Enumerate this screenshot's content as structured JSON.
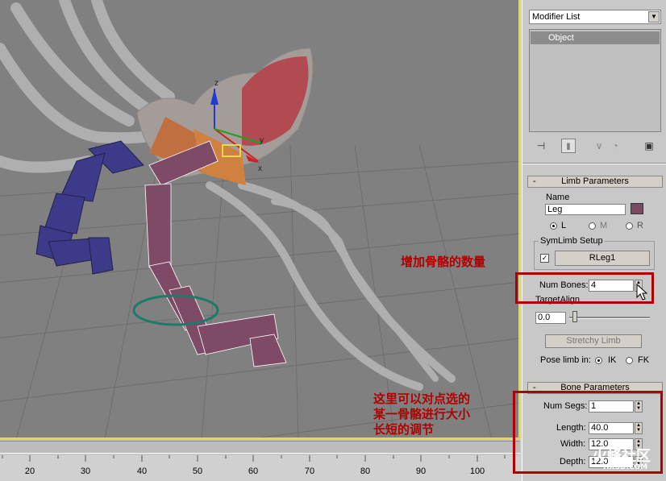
{
  "annotations": {
    "numbones_note": "增加骨骼的数量",
    "adjust_note_line1": "这里可以对点选的",
    "adjust_note_line2": "某一骨骼进行大小",
    "adjust_note_line3": "长短的调节"
  },
  "viewport": {
    "gizmo_labels": {
      "x": "x",
      "y": "y",
      "z": "z"
    }
  },
  "timeline": {
    "ticks": [
      "20",
      "30",
      "40",
      "50",
      "60",
      "70",
      "80",
      "90",
      "100"
    ]
  },
  "panel": {
    "modifier_list": "Modifier List",
    "stack_item": "Object",
    "icons": [
      "pin-stack-icon",
      "show-end-result-icon",
      "make-unique-icon",
      "remove-modifier-icon",
      "configure-sets-icon"
    ],
    "limb": {
      "title": "Limb Parameters",
      "name_label": "Name",
      "name_value": "Leg",
      "color": "#7a4a60",
      "side_l": "L",
      "side_m": "M",
      "side_r": "R",
      "symlimb_label": "SymLimb Setup",
      "symlimb_button": "RLeg1",
      "num_bones_label": "Num Bones:",
      "num_bones_value": "4",
      "target_align_label": "TargetAlign",
      "target_align_value": "0.0",
      "stretchy_button": "Stretchy Limb",
      "pose_label": "Pose limb in:",
      "ik_label": "IK",
      "fk_label": "FK"
    },
    "bone": {
      "title": "Bone Parameters",
      "num_segs_label": "Num Segs:",
      "num_segs_value": "1",
      "length_label": "Length:",
      "length_value": "40.0",
      "width_label": "Width:",
      "width_value": "12.0",
      "depth_label": "Depth:",
      "depth_value": "12.0"
    }
  },
  "watermark": {
    "brand": "火峰社区",
    "domain": "HXSD.COM"
  }
}
